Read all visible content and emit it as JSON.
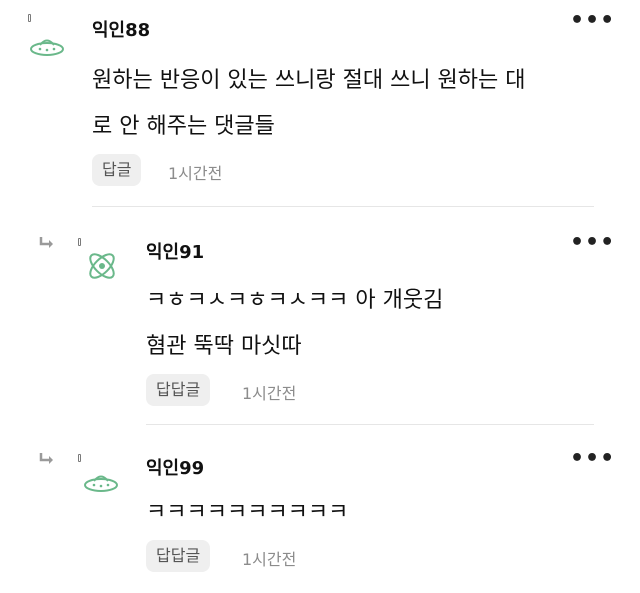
{
  "comments": [
    {
      "nickname": "익인88",
      "lines": [
        "원하는 반응이 있는 쓰니랑 절대 쓰니 원하는 대",
        "로 안 해주는 댓글들"
      ],
      "reply_label": "답글",
      "time": "1시간전",
      "avatar_icon": "ufo-icon",
      "more_label": "•••"
    },
    {
      "nickname": "익인91",
      "lines": [
        "ㅋㅎㅋㅅㅋㅎㅋㅅㅋㅋ 아 개웃김",
        "혐관 뚝딱 마싯따"
      ],
      "reply_label": "답답글",
      "time": "1시간전",
      "avatar_icon": "atom-icon",
      "more_label": "•••"
    },
    {
      "nickname": "익인99",
      "lines": [
        "ㅋㅋㅋㅋㅋㅋㅋㅋㅋㅋ"
      ],
      "reply_label": "답답글",
      "time": "1시간전",
      "avatar_icon": "ufo-icon",
      "more_label": "•••"
    }
  ],
  "colors": {
    "avatar": "#6ab88a",
    "divider": "#e6e6e6",
    "reply_bg": "#efefef"
  }
}
